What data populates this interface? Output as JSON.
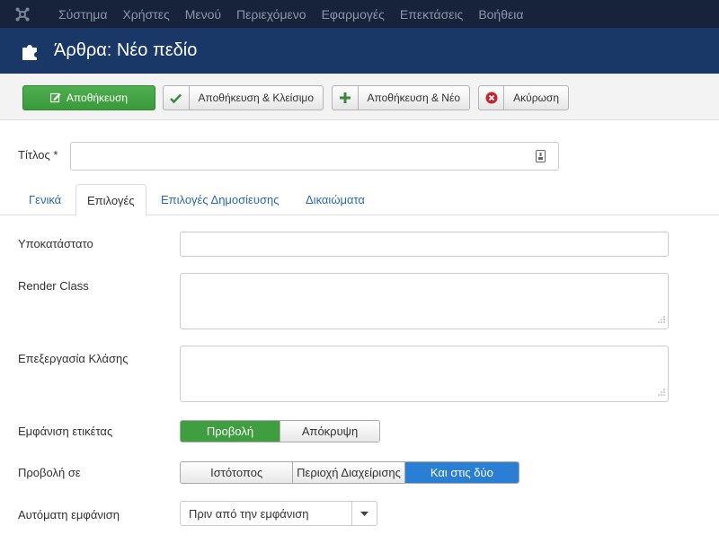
{
  "menubar": {
    "items": [
      "Σύστημα",
      "Χρήστες",
      "Μενού",
      "Περιεχόμενο",
      "Εφαρμογές",
      "Επεκτάσεις",
      "Βοήθεια"
    ]
  },
  "header": {
    "title": "Άρθρα: Νέο πεδίο"
  },
  "toolbar": {
    "save_label": "Αποθήκευση",
    "save_close_label": "Αποθήκευση & Κλείσιμο",
    "save_new_label": "Αποθήκευση & Νέο",
    "cancel_label": "Ακύρωση"
  },
  "title_field": {
    "label": "Τίτλος *",
    "value": ""
  },
  "tabs": [
    {
      "label": "Γενικά",
      "active": false
    },
    {
      "label": "Επιλογές",
      "active": true
    },
    {
      "label": "Επιλογές Δημοσίευσης",
      "active": false
    },
    {
      "label": "Δικαιώματα",
      "active": false
    }
  ],
  "form": {
    "placeholder_label": "Υποκατάστατο",
    "placeholder_value": "",
    "render_class_label": "Render Class",
    "render_class_value": "",
    "edit_class_label": "Επεξεργασία Κλάσης",
    "edit_class_value": "",
    "show_label": {
      "label": "Εμφάνιση ετικέτας",
      "options": [
        "Προβολή",
        "Απόκρυψη"
      ],
      "selected": "Προβολή"
    },
    "show_on": {
      "label": "Προβολή σε",
      "options": [
        "Ιστότοπος",
        "Περιοχή Διαχείρισης",
        "Και στις δύο"
      ],
      "selected": "Και στις δύο"
    },
    "automatic_display": {
      "label": "Αυτόματη εμφάνιση",
      "value": "Πριν από την εμφάνιση"
    }
  },
  "colors": {
    "menubar_bg": "#17233a",
    "header_bg": "#1a3867",
    "save_green": "#3f9e3f",
    "selected_blue": "#2a7fd4",
    "link_blue": "#2a69b8"
  }
}
